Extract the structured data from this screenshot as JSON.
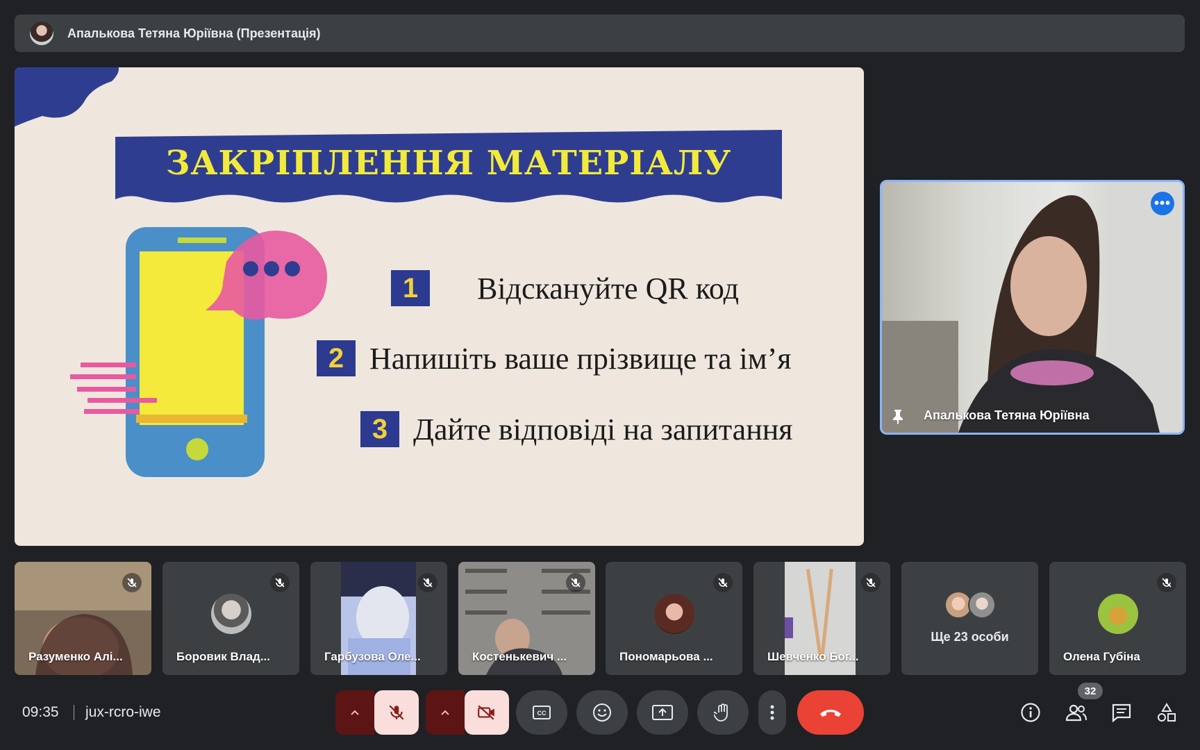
{
  "presenter_bar": {
    "title": "Апалькова Тетяна Юріївна (Презентація)"
  },
  "slide": {
    "title": "ЗАКРІПЛЕННЯ МАТЕРІАЛУ",
    "steps": [
      {
        "num": "1",
        "text": "Відскануйте QR код"
      },
      {
        "num": "2",
        "text": "Напишіть ваше прізвище та ім’я"
      },
      {
        "num": "3",
        "text": "Дайте відповіді на запитання"
      }
    ]
  },
  "speaker": {
    "name": "Апалькова Тетяна Юріївна",
    "more_icon": "more-horiz-icon",
    "pin_icon": "pin-icon"
  },
  "participants": [
    {
      "name": "Разуменко Алі...",
      "muted": true
    },
    {
      "name": "Боровик Влад...",
      "muted": true
    },
    {
      "name": "Гарбузова Оле...",
      "muted": true
    },
    {
      "name": "Костенькевич ...",
      "muted": true
    },
    {
      "name": "Пономарьова ...",
      "muted": true
    },
    {
      "name": "Шевченко Бог...",
      "muted": true
    },
    {
      "name": "Ще 23 особи",
      "muted": false
    },
    {
      "name": "Олена Губіна",
      "muted": true
    }
  ],
  "controls": {
    "time": "09:35",
    "meeting_code": "jux-rcro-iwe",
    "people_count": "32"
  },
  "colors": {
    "background": "#202124",
    "tile": "#3c4043",
    "hangup": "#ea4335",
    "accent": "#8ab4f8",
    "muted_button": "#f9dedc"
  }
}
